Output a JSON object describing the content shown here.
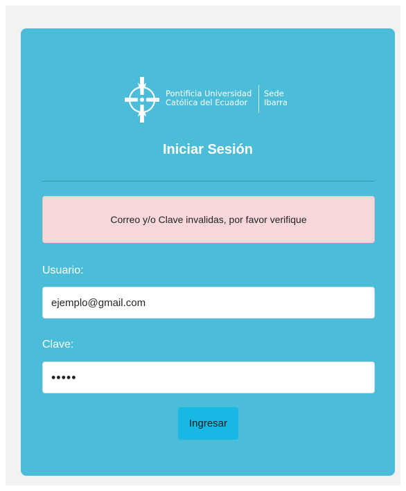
{
  "logo": {
    "line1": "Pontificia Universidad",
    "line2": "Católica del Ecuador",
    "campus_line1": "Sede",
    "campus_line2": "Ibarra"
  },
  "login": {
    "title": "Iniciar Sesión",
    "alert_message": "Correo y/o Clave invalidas, por favor verifique",
    "user_label": "Usuario:",
    "user_value": "ejemplo@gmail.com",
    "password_label": "Clave:",
    "password_value": "•••••",
    "submit_label": "Ingresar"
  },
  "colors": {
    "card": "#4bbdd9",
    "alert_bg": "#f8d7da",
    "button": "#17b8e3"
  }
}
